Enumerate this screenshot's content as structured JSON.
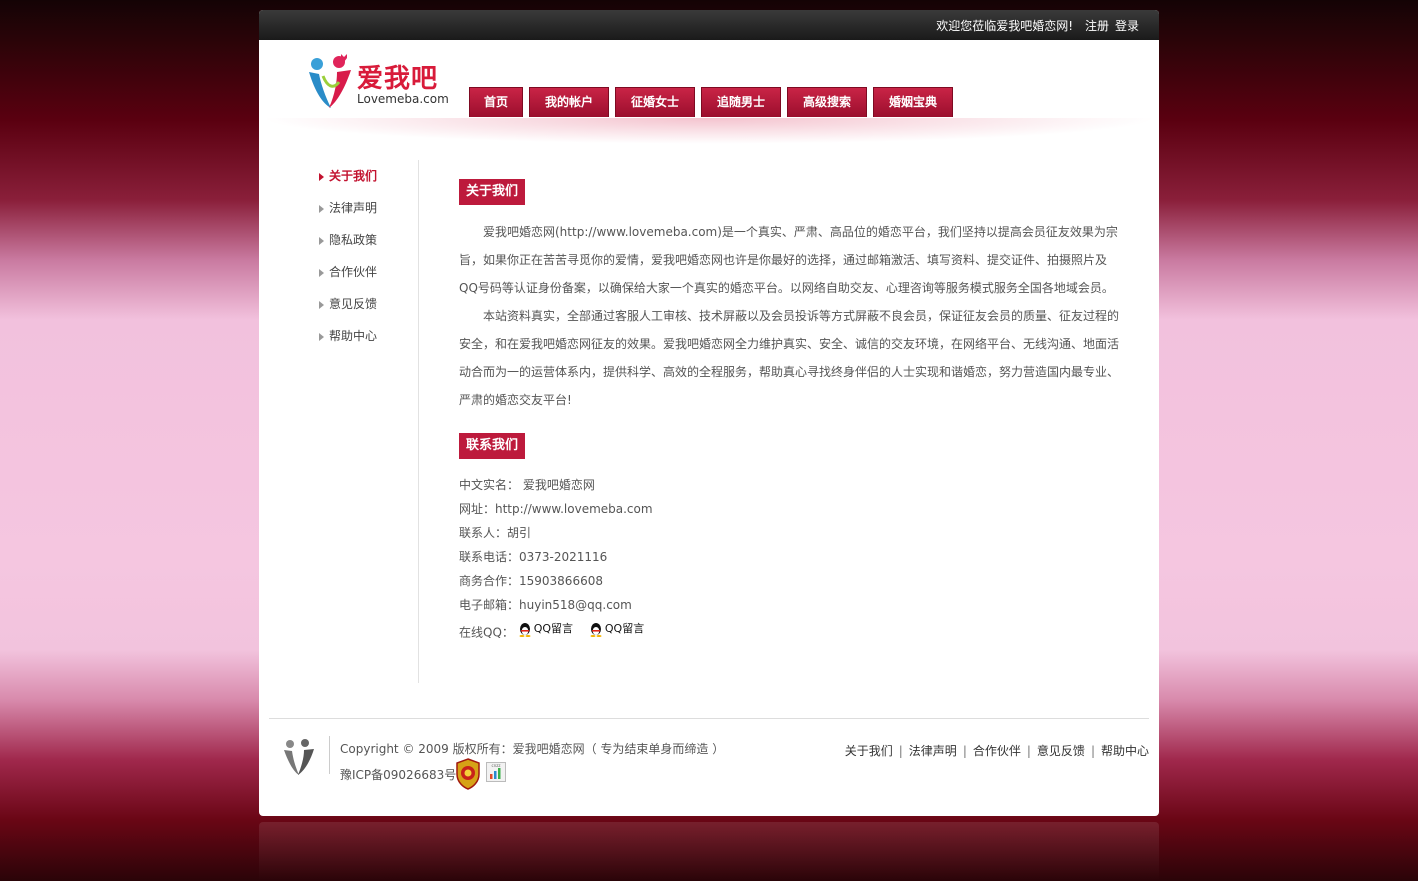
{
  "topbar": {
    "welcome": "欢迎您莅临爱我吧婚恋网!",
    "register": "注册",
    "login": "登录"
  },
  "logo": {
    "name": "爱我吧",
    "domain": "Lovemeba.com"
  },
  "nav": {
    "items": [
      "首页",
      "我的帐户",
      "征婚女士",
      "追随男士",
      "高级搜索",
      "婚姻宝典"
    ]
  },
  "sidebar": {
    "items": [
      "关于我们",
      "法律声明",
      "隐私政策",
      "合作伙伴",
      "意见反馈",
      "帮助中心"
    ],
    "active_index": 0
  },
  "about": {
    "title": "关于我们",
    "paragraphs": [
      "爱我吧婚恋网(http://www.lovemeba.com)是一个真实、严肃、高品位的婚恋平台，我们坚持以提高会员征友效果为宗旨，如果你正在苦苦寻觅你的爱情，爱我吧婚恋网也许是你最好的选择，通过邮箱激活、填写资料、提交证件、拍摄照片及QQ号码等认证身份备案，以确保给大家一个真实的婚恋平台。以网络自助交友、心理咨询等服务模式服务全国各地域会员。",
      "本站资料真实，全部通过客服人工审核、技术屏蔽以及会员投诉等方式屏蔽不良会员，保证征友会员的质量、征友过程的安全，和在爱我吧婚恋网征友的效果。爱我吧婚恋网全力维护真实、安全、诚信的交友环境，在网络平台、无线沟通、地面活动合而为一的运营体系内，提供科学、高效的全程服务，帮助真心寻找终身伴侣的人士实现和谐婚恋，努力营造国内最专业、严肃的婚恋交友平台!"
    ]
  },
  "contact": {
    "title": "联系我们",
    "rows": [
      "中文实名： 爱我吧婚恋网",
      "网址：http://www.lovemeba.com",
      "联系人：胡引",
      "联系电话：0373-2021116",
      "商务合作：15903866608",
      "电子邮箱：huyin518@qq.com"
    ],
    "qq_label": "在线QQ：",
    "qq_buttons": [
      "QQ留言",
      "QQ留言"
    ]
  },
  "footer": {
    "copyright": "Copyright © 2009 版权所有：爱我吧婚恋网（ 专为结束单身而缔造 ）",
    "icp": "豫ICP备09026683号",
    "links": [
      "关于我们",
      "法律声明",
      "合作伙伴",
      "意见反馈",
      "帮助中心"
    ],
    "badge_cnzz": "cnzz"
  },
  "colors": {
    "accent": "#bd1a3c",
    "active_text": "#c2122f",
    "topbar": "#1a1a1a"
  }
}
